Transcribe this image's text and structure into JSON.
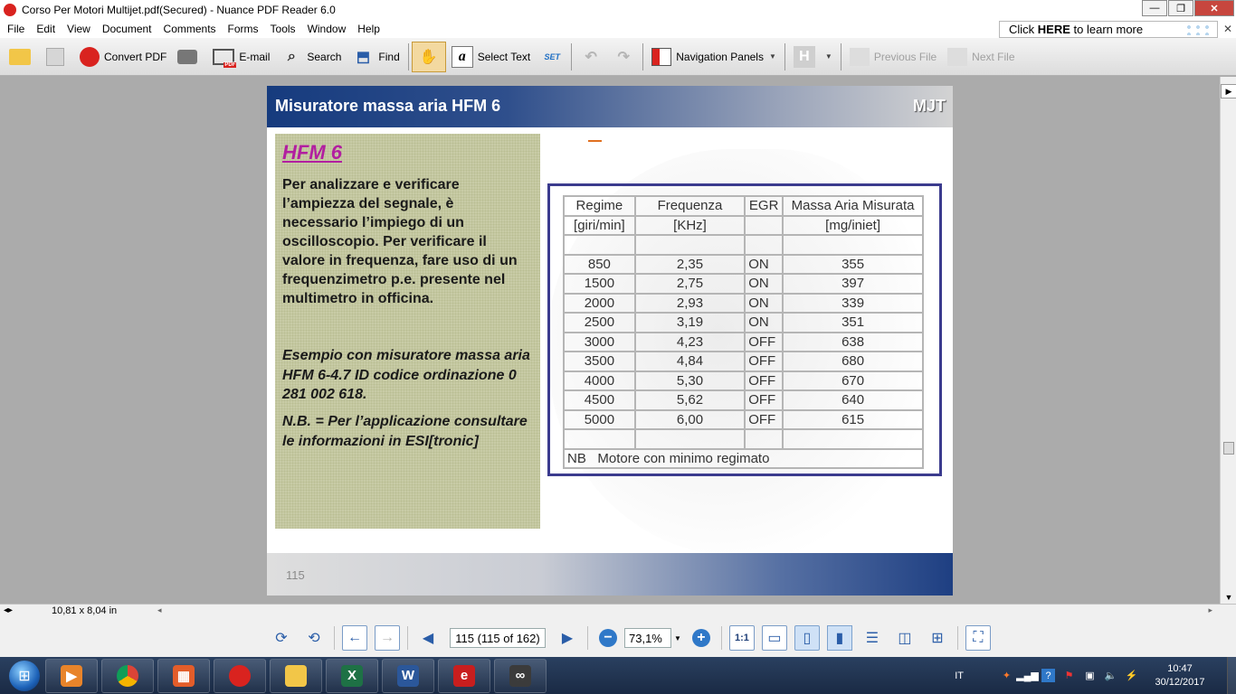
{
  "window": {
    "title": "Corso Per Motori Multijet.pdf(Secured) - Nuance PDF Reader 6.0",
    "controls": {
      "minimize": "—",
      "maximize": "❐",
      "close": "✕"
    }
  },
  "menu": {
    "items": [
      "File",
      "Edit",
      "View",
      "Document",
      "Comments",
      "Forms",
      "Tools",
      "Window",
      "Help"
    ],
    "promo_prefix": "Click ",
    "promo_bold": "HERE",
    "promo_suffix": " to learn more",
    "close": "✕"
  },
  "toolbar": {
    "convert_pdf": "Convert PDF",
    "email": "E-mail",
    "search": "Search",
    "find": "Find",
    "select_text": "Select Text",
    "navigation_panels": "Navigation Panels",
    "previous_file": "Previous File",
    "next_file": "Next File",
    "set_label": "SET",
    "pdf_label": "PDF",
    "h_label": "H"
  },
  "slide": {
    "title": "Misuratore massa aria HFM 6",
    "badge": "MJT",
    "panel_heading": "HFM 6",
    "paragraph1": "Per analizzare e verificare l’ampiezza del segnale, è necessario l’impiego di un oscilloscopio. Per verificare il valore in frequenza, fare uso di un frequenzimetro p.e. presente nel multimetro in officina.",
    "paragraph2": "Esempio con misuratore massa aria HFM 6-4.7 ID codice ordinazione 0 281 002 618.",
    "paragraph3": "N.B. = Per l’applicazione consultare le informazioni in ESI[tronic]",
    "page_number": "115",
    "table": {
      "headers": [
        "Regime",
        "Frequenza",
        "EGR",
        "Massa Aria Misurata"
      ],
      "units": [
        "[giri/min]",
        "[KHz]",
        "",
        "[mg/iniet]"
      ],
      "rows": [
        [
          "850",
          "2,35",
          "ON",
          "355"
        ],
        [
          "1500",
          "2,75",
          "ON",
          "397"
        ],
        [
          "2000",
          "2,93",
          "ON",
          "339"
        ],
        [
          "2500",
          "3,19",
          "ON",
          "351"
        ],
        [
          "3000",
          "4,23",
          "OFF",
          "638"
        ],
        [
          "3500",
          "4,84",
          "OFF",
          "680"
        ],
        [
          "4000",
          "5,30",
          "OFF",
          "670"
        ],
        [
          "4500",
          "5,62",
          "OFF",
          "640"
        ],
        [
          "5000",
          "6,00",
          "OFF",
          "615"
        ]
      ],
      "note_label": "NB",
      "note_text": "Motore con minimo regimato"
    }
  },
  "statusbar": {
    "page_size": "10,81 x 8,04 in"
  },
  "navbar": {
    "page_field": "115 (115 of 162)",
    "zoom": "73,1%",
    "actual_size_label": "1:1"
  },
  "taskbar": {
    "language": "IT",
    "time": "10:47",
    "date": "30/12/2017"
  },
  "colors": {
    "slide_header_blue": "#163b7e",
    "heading_magenta": "#b21fa0",
    "table_border_navy": "#3b3b8e",
    "panel_olive": "#c8cba6"
  }
}
